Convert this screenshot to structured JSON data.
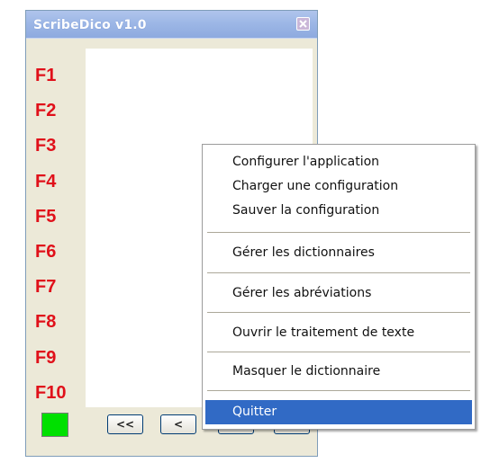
{
  "window": {
    "title": "ScribeDico v1.0",
    "close_icon": "close-icon"
  },
  "fkeys": [
    "F1",
    "F2",
    "F3",
    "F4",
    "F5",
    "F6",
    "F7",
    "F8",
    "F9",
    "F10"
  ],
  "navigation": {
    "first_label": "<<",
    "prev_label": "<",
    "next_label": ">",
    "last_label": ">>"
  },
  "status_color": "#00e000",
  "context_menu": {
    "items": [
      "Configurer l'application",
      "Charger une configuration",
      "Sauver la configuration",
      "Gérer les dictionnaires",
      "Gérer les abréviations",
      "Ouvrir le traitement de texte",
      "Masquer le dictionnaire",
      "Quitter"
    ],
    "selected_index": 7,
    "selected_color": "#316ac5"
  }
}
